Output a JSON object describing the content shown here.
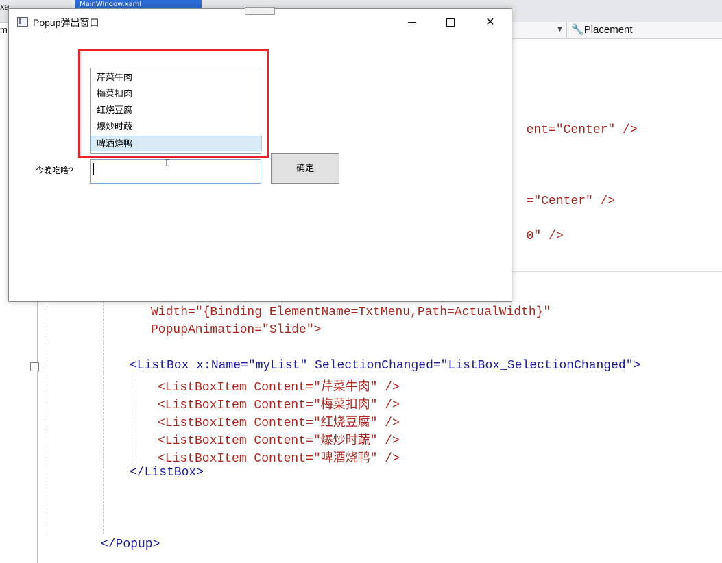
{
  "ide": {
    "tab_label": "MainWindow.xaml",
    "corner_top": "xa",
    "corner_left": "m",
    "placement_label": "Placement",
    "partial_code": {
      "line1": "ent=\"Center\" />",
      "line2": "=\"Center\" />",
      "line3": "0\" />"
    },
    "code_lines": {
      "width_attr": "Width=\"{Binding ElementName=TxtMenu,Path=ActualWidth}\"",
      "anim_attr": "PopupAnimation=\"Slide\">",
      "listbox_open": "<ListBox x:Name=\"myList\" SelectionChanged=\"ListBox_SelectionChanged\">",
      "item1": "<ListBoxItem Content=\"芹菜牛肉\" />",
      "item2": "<ListBoxItem Content=\"梅菜扣肉\" />",
      "item3": "<ListBoxItem Content=\"红烧豆腐\" />",
      "item4": "<ListBoxItem Content=\"爆炒时蔬\" />",
      "item5": "<ListBoxItem Content=\"啤酒烧鸭\" />",
      "listbox_close": "</ListBox>",
      "popup_close": "</Popup>"
    }
  },
  "window": {
    "title": "Popup弹出窗口",
    "close_glyph": "✕"
  },
  "listbox": {
    "items": [
      "芹菜牛肉",
      "梅菜扣肉",
      "红烧豆腐",
      "爆炒时蔬",
      "啤酒烧鸭"
    ],
    "selected_index": 4
  },
  "form": {
    "prompt_label": "今晚吃啥?",
    "input_value": "",
    "ok_label": "确定"
  },
  "colors": {
    "highlight": "#e8202a",
    "selection": "#d9eaf7",
    "code_red": "#b1261e",
    "code_blue": "#1a1aa6"
  }
}
